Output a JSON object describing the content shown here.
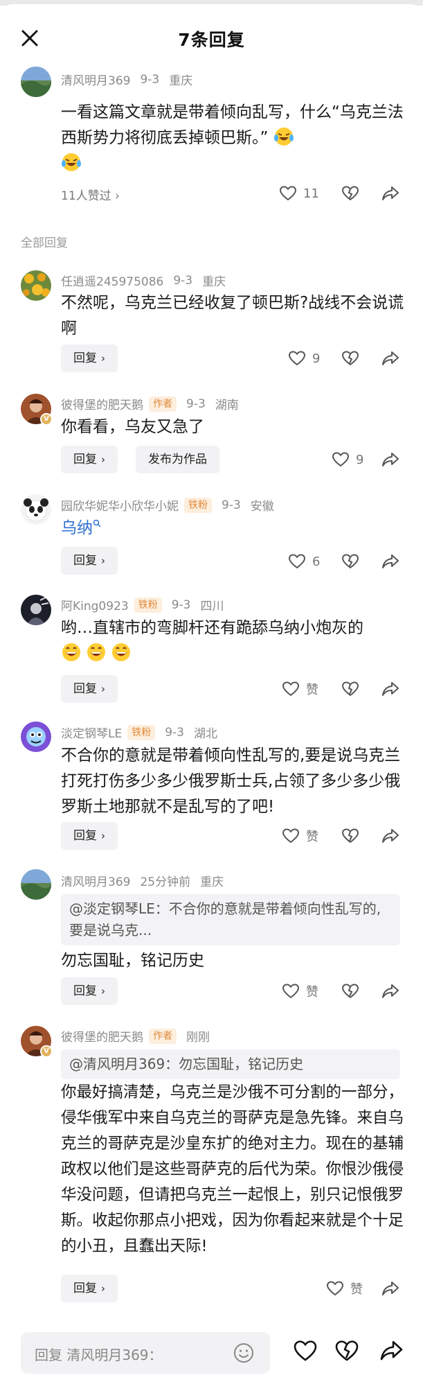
{
  "header": {
    "title": "7条回复"
  },
  "main_comment": {
    "username": "清风明月369",
    "date": "9-3",
    "location": "重庆",
    "text": "一看这篇文章就是带着倾向乱写，什么“乌克兰法西斯势力将彻底丢掉顿巴斯。”",
    "liked_by": "11人赞过",
    "like_count": "11"
  },
  "section_label": "全部回复",
  "replies": [
    {
      "username": "任逍遥245975086",
      "date": "9-3",
      "location": "重庆",
      "text": "不然呢，乌克兰已经收复了顿巴斯?战线不会说谎啊",
      "reply_label": "回复",
      "like_count": "9"
    },
    {
      "username": "彼得堡的肥天鹅",
      "tag": "作者",
      "date": "9-3",
      "location": "湖南",
      "text": "你看看，乌友又急了",
      "reply_label": "回复",
      "publish_label": "发布为作品",
      "like_count": "9"
    },
    {
      "username": "园欣华妮华小欣华小妮",
      "tag": "铁粉",
      "date": "9-3",
      "location": "安徽",
      "link_text": "乌纳",
      "reply_label": "回复",
      "like_count": "6"
    },
    {
      "username": "阿King0923",
      "tag": "铁粉",
      "date": "9-3",
      "location": "四川",
      "text": "哟…直辖市的弯脚杆还有跪舔乌纳小炮灰的",
      "reply_label": "回复",
      "like_count": "赞"
    },
    {
      "username": "淡定钢琴LE",
      "tag": "铁粉",
      "date": "9-3",
      "location": "湖北",
      "text": "不合你的意就是带着倾向性乱写的,要是说乌克兰打死打伤多少多少俄罗斯士兵,占领了多少多少俄罗斯土地那就不是乱写的了吧!",
      "reply_label": "回复",
      "like_count": "赞"
    },
    {
      "username": "清风明月369",
      "date": "25分钟前",
      "location": "重庆",
      "quote": "@淡定钢琴LE：不合你的意就是带着倾向性乱写的,要是说乌克...",
      "text": "勿忘国耻，铭记历史",
      "reply_label": "回复",
      "like_count": "赞"
    },
    {
      "username": "彼得堡的肥天鹅",
      "tag": "作者",
      "date": "刚刚",
      "quote": "@清风明月369：勿忘国耻，铭记历史",
      "text": "你最好搞清楚，乌克兰是沙俄不可分割的一部分，侵华俄军中来自乌克兰的哥萨克是急先锋。来自乌克兰的哥萨克是沙皇东扩的绝对主力。现在的基辅政权以他们是这些哥萨克的后代为荣。你恨沙俄侵华没问题，但请把乌克兰一起恨上，别只记恨俄罗斯。收起你那点小把戏，因为你看起来就是个十足的小丑，且蠢出天际!",
      "reply_label": "回复",
      "like_count": "赞"
    }
  ],
  "bottom_bar": {
    "reply_placeholder": "回复 清风明月369："
  }
}
